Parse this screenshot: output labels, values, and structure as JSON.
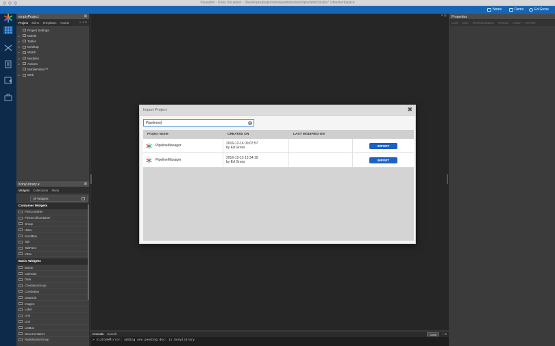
{
  "window": {
    "title": "Visualizer - Kony Visualizer - /Developer/projects/konywebstudio/eclipse/WebStudio7.1/bin/workspace"
  },
  "topbar": {
    "notes_label": "Notes",
    "demo_label": "Demo",
    "user_label": "Ed Gross"
  },
  "project_panel": {
    "title": "emptyProject",
    "tabs": [
      "Project",
      "Skins",
      "Templates",
      "Assets"
    ],
    "tree": [
      {
        "label": "Project Settings",
        "icon": "settings-icon"
      },
      {
        "label": "Mobile",
        "icon": "mobile-icon"
      },
      {
        "label": "Tablet",
        "icon": "tablet-icon"
      },
      {
        "label": "Desktop",
        "icon": "desktop-icon"
      },
      {
        "label": "Watch",
        "icon": "watch-icon"
      },
      {
        "label": "Modules",
        "icon": "modules-icon"
      },
      {
        "label": "Actions",
        "icon": "actions-icon"
      },
      {
        "label": "MobileFabric™",
        "icon": "fabric-icon"
      },
      {
        "label": "Web",
        "icon": "web-icon"
      }
    ]
  },
  "library": {
    "title": "KonyLibrary ▾",
    "tabs": [
      "Widgets",
      "Collections",
      "Skins"
    ],
    "filter": "All Widgets",
    "sections": [
      {
        "title": "Container Widgets",
        "items": [
          "FlexContainer",
          "FlexScrollContainer",
          "Group",
          "HBox",
          "ScrollBox",
          "Tab",
          "TabPane",
          "VBox"
        ]
      },
      {
        "title": "Basic Widgets",
        "items": [
          "Button",
          "Calendar",
          "Data",
          "CheckBoxGroup",
          "ComboBox",
          "DataGrid",
          "Image2",
          "Label",
          "Line",
          "Link",
          "ListBox",
          "MenuContainer",
          "RadioButtonGroup"
        ]
      }
    ]
  },
  "properties": {
    "title": "Properties",
    "tabs": [
      "Look",
      "Skin",
      "Flex/Orientation",
      "Review",
      "Action",
      "Review"
    ]
  },
  "console": {
    "tabs": [
      "Console",
      "Search"
    ],
    "clear_label": "Clear",
    "log": "> vizCodeMirror: adding one pending doc: js_konylibrary"
  },
  "modal": {
    "title": "Import Project",
    "search_value": "Pipelinem",
    "columns": [
      "Project Name",
      "CREATED ON",
      "LAST MODIFIED ON"
    ],
    "rows": [
      {
        "name": "PipelineManager",
        "created": "2016-12-16 00:07:57",
        "by": "by Ed Gross",
        "modified": "",
        "action": "IMPORT"
      },
      {
        "name": "PipelineManager",
        "created": "2016-12-13 13:34:19",
        "by": "by Ed Gross",
        "modified": "",
        "action": "IMPORT"
      }
    ]
  },
  "colors": {
    "accent": "#1565b7",
    "nav": "#0d2a4a",
    "import_button": "#1c62c4"
  }
}
